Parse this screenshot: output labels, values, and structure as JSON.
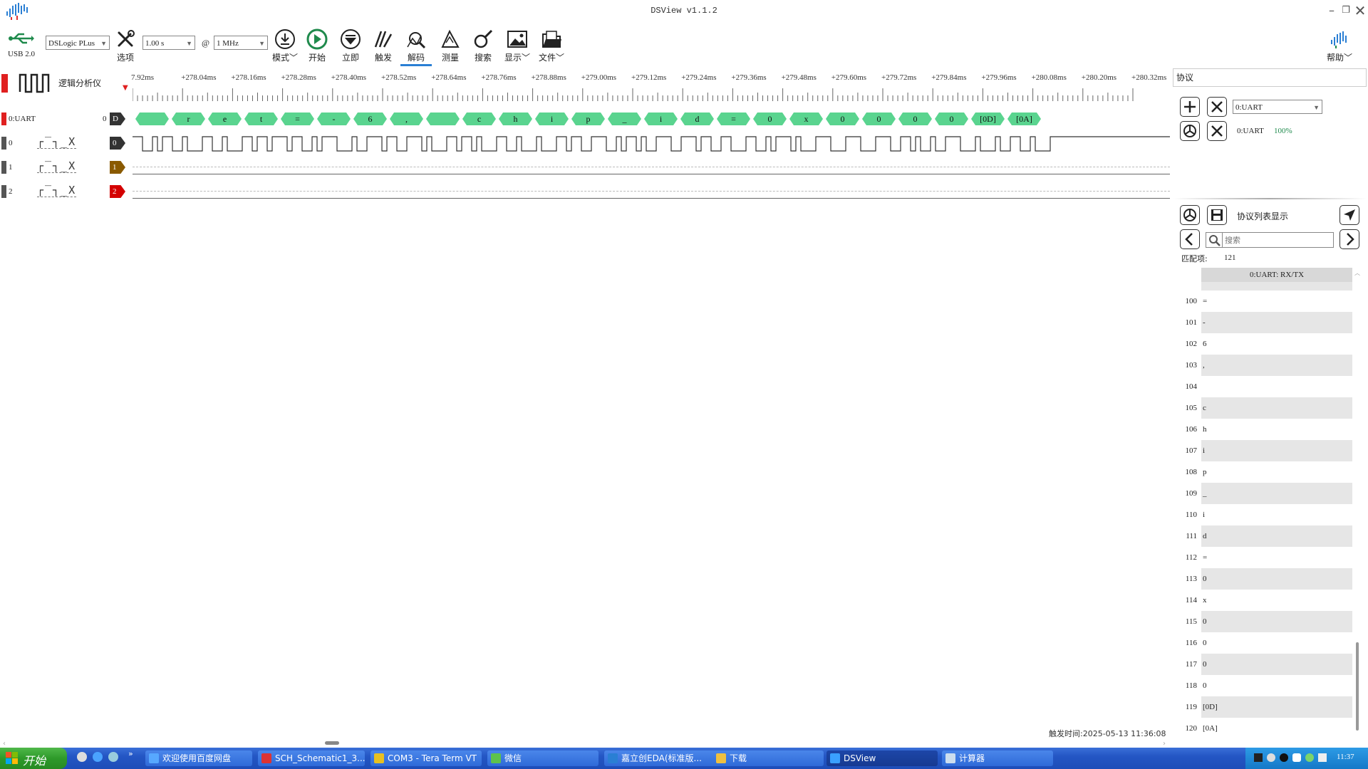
{
  "app": {
    "title": "DSView v1.1.2"
  },
  "toolbar": {
    "usb_label": "USB 2.0",
    "device": "DSLogic PLus",
    "options_label": "选项",
    "duration": "1.00 s",
    "at_sign": "@",
    "samplerate": "1 MHz",
    "mode_label": "模式",
    "start_label": "开始",
    "instant_label": "立即",
    "trigger_label": "触发",
    "decode_label": "解码",
    "measure_label": "测量",
    "search_label": "搜索",
    "display_label": "显示",
    "file_label": "文件",
    "help_label": "帮助",
    "accent": "#1f8a4c"
  },
  "ruler": {
    "device_label": "逻辑分析仪",
    "ticks": [
      "7.92ms",
      "+278.04ms",
      "+278.16ms",
      "+278.28ms",
      "+278.40ms",
      "+278.52ms",
      "+278.64ms",
      "+278.76ms",
      "+278.88ms",
      "+279.00ms",
      "+279.12ms",
      "+279.24ms",
      "+279.36ms",
      "+279.48ms",
      "+279.60ms",
      "+279.72ms",
      "+279.84ms",
      "+279.96ms",
      "+280.08ms",
      "+280.20ms",
      "+280.32ms"
    ]
  },
  "channels": {
    "decoder": {
      "name": "0:UART",
      "index": "0",
      "tag": "D",
      "color": "#333333"
    },
    "ch0": {
      "name": "0",
      "tag": "0",
      "color": "#333333"
    },
    "ch1": {
      "name": "1",
      "tag": "1",
      "color": "#8a5a00"
    },
    "ch2": {
      "name": "2",
      "tag": "2",
      "color": "#d40000"
    },
    "trigger_glyphs": "┌‾┐_X"
  },
  "decode_values": [
    "",
    "r",
    "e",
    "t",
    "=",
    "-",
    "6",
    ",",
    "",
    "c",
    "h",
    "i",
    "p",
    "_",
    "i",
    "d",
    "=",
    "0",
    "x",
    "0",
    "0",
    "0",
    "0",
    "[0D]",
    "[0A]"
  ],
  "protocol_panel": {
    "header": "协议",
    "decoder_select": "0:UART",
    "decoder_name": "0:UART",
    "progress": "100%",
    "list_title": "协议列表显示",
    "search_placeholder": "搜索",
    "match_label": "匹配项:",
    "match_count": "121",
    "column_header": "0:UART: RX/TX",
    "rows": [
      {
        "idx": "100",
        "val": "="
      },
      {
        "idx": "101",
        "val": "-"
      },
      {
        "idx": "102",
        "val": "6"
      },
      {
        "idx": "103",
        "val": ","
      },
      {
        "idx": "104",
        "val": ""
      },
      {
        "idx": "105",
        "val": "c"
      },
      {
        "idx": "106",
        "val": "h"
      },
      {
        "idx": "107",
        "val": "i"
      },
      {
        "idx": "108",
        "val": "p"
      },
      {
        "idx": "109",
        "val": "_"
      },
      {
        "idx": "110",
        "val": "i"
      },
      {
        "idx": "111",
        "val": "d"
      },
      {
        "idx": "112",
        "val": "="
      },
      {
        "idx": "113",
        "val": "0"
      },
      {
        "idx": "114",
        "val": "x"
      },
      {
        "idx": "115",
        "val": "0"
      },
      {
        "idx": "116",
        "val": "0"
      },
      {
        "idx": "117",
        "val": "0"
      },
      {
        "idx": "118",
        "val": "0"
      },
      {
        "idx": "119",
        "val": "[0D]"
      },
      {
        "idx": "120",
        "val": "[0A]"
      }
    ]
  },
  "status": {
    "trigger_time": "触发时间:2025-05-13 11:36:08"
  },
  "taskbar": {
    "start_label": "开始",
    "tasks": [
      "欢迎使用百度网盘",
      "SCH_Schematic1_3...",
      "COM3 - Tera Term VT",
      "微信",
      "嘉立创EDA(标准版...",
      "下载",
      "DSView",
      "计算器"
    ],
    "clock": "11:37"
  }
}
